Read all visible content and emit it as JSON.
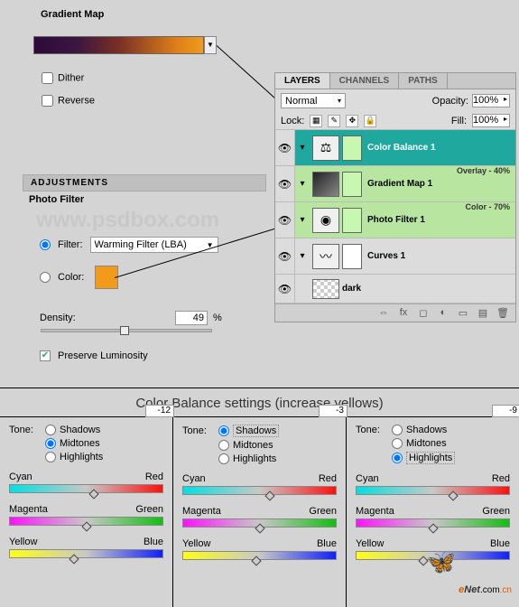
{
  "gradientMap": {
    "title": "Gradient Map",
    "dither": "Dither",
    "reverse": "Reverse"
  },
  "adjustments": {
    "header": "ADJUSTMENTS",
    "photoFilter": "Photo Filter",
    "filterLabel": "Filter:",
    "filterValue": "Warming Filter (LBA)",
    "colorLabel": "Color:",
    "densityLabel": "Density:",
    "densityValue": "49",
    "pct": "%",
    "preserve": "Preserve Luminosity"
  },
  "watermark": "www.psdbox.com",
  "layers": {
    "tabs": [
      "LAYERS",
      "CHANNELS",
      "PATHS"
    ],
    "blendMode": "Normal",
    "opacityLabel": "Opacity:",
    "opacityVal": "100%",
    "lockLabel": "Lock:",
    "fillLabel": "Fill:",
    "fillVal": "100%",
    "items": [
      {
        "name": "Color Balance 1",
        "meta": ""
      },
      {
        "name": "Gradient Map 1",
        "meta": "Overlay - 40%"
      },
      {
        "name": "Photo Filter 1",
        "meta": "Color - 70%"
      },
      {
        "name": "Curves 1",
        "meta": ""
      },
      {
        "name": "dark",
        "meta": ""
      }
    ]
  },
  "cbSettings": {
    "title": "Color Balance settings (increase yellows)",
    "toneLabel": "Tone:",
    "tones": [
      "Shadows",
      "Midtones",
      "Highlights"
    ],
    "pairs": [
      [
        "Cyan",
        "Red"
      ],
      [
        "Magenta",
        "Green"
      ],
      [
        "Yellow",
        "Blue"
      ]
    ],
    "cols": [
      {
        "selected": 1,
        "vals": [
          "+6",
          "0",
          "-12"
        ],
        "thumbs": [
          55,
          50,
          42
        ]
      },
      {
        "selected": 0,
        "vals": [
          "+9",
          "0",
          "-3"
        ],
        "thumbs": [
          57,
          50,
          48
        ]
      },
      {
        "selected": 2,
        "vals": [
          "+19",
          "0",
          "-9"
        ],
        "thumbs": [
          63,
          50,
          44
        ]
      }
    ]
  },
  "branding": {
    "e": "e",
    "net": "Net",
    "dot": ".com",
    "cn": ".cn"
  }
}
